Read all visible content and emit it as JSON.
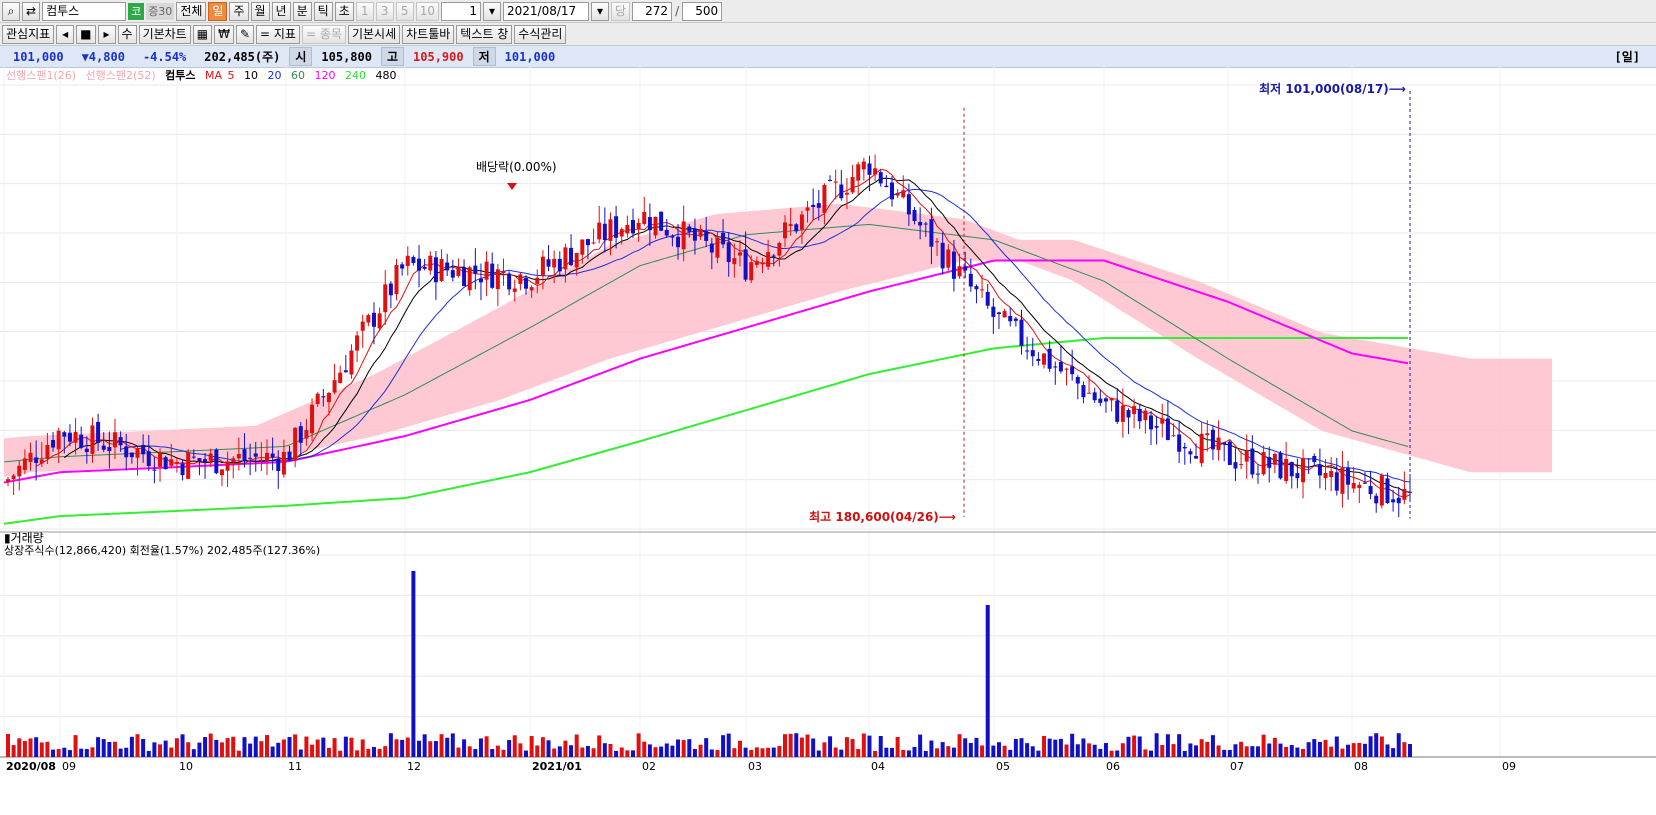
{
  "toolbar": {
    "stock_name": "컴투스",
    "market_badge": "코",
    "ratio_badge": "증30",
    "period_all": "전체",
    "period_day": "일",
    "period_week": "주",
    "period_month": "월",
    "period_year": "년",
    "period_min": "분",
    "period_tick": "틱",
    "period_sec": "초",
    "n1": "1",
    "n3": "3",
    "n5": "5",
    "n10": "10",
    "interval_value": "1",
    "date_value": "2021/08/17",
    "dang_label": "당",
    "count_value": "272",
    "slash": "/",
    "total_value": "500"
  },
  "toolbar2": {
    "fav_indicator": "관심지표",
    "basic_chart": "기본차트",
    "won": "₩",
    "add_indicator": "지표",
    "add_item": "종목",
    "basic_price": "기본시세",
    "chart_toolbar": "차트툴바",
    "text_window": "텍스트 창",
    "formula_mgmt": "수식관리"
  },
  "quote": {
    "price": "101,000",
    "change": "▼4,800",
    "change_pct": "-4.54%",
    "volume": "202,485(주)",
    "open_label": "시",
    "open": "105,800",
    "high_label": "고",
    "high": "105,900",
    "low_label": "저",
    "low": "101,000",
    "period_tag": "[일]"
  },
  "legend": {
    "span1": "선행스팬1(26)",
    "span2": "선행스팬2(52)",
    "name": "컴투스",
    "ma_label": "MA",
    "ma5": "5",
    "ma10": "10",
    "ma20": "20",
    "ma60": "60",
    "ma120": "120",
    "ma240": "240",
    "ma480": "480"
  },
  "colors": {
    "up": "#e01010",
    "down": "#1010c8",
    "ma5": "#e01010",
    "ma10": "#000000",
    "ma20": "#1a2fe0",
    "ma60": "#2e8b57",
    "ma120": "#ff00ff",
    "ma240": "#33ee33",
    "ma480": "#000000",
    "cloud": "#ffc0cb",
    "max_marker": "#d01010",
    "min_marker": "#1a1aa0"
  },
  "chart_data": {
    "type": "candlestick",
    "annotations": {
      "dividend": "배당락(0.00%)",
      "max": "최고 180,600(04/26)",
      "min": "최저 101,000(08/17)",
      "max_value": 180600,
      "min_value": 101000
    },
    "x_ticks": [
      "2020/08",
      "09",
      "10",
      "11",
      "12",
      "2021/01",
      "02",
      "03",
      "04",
      "05",
      "06",
      "07",
      "08",
      "09"
    ],
    "volume_panel": {
      "title": "거래량",
      "info": "상장주식수(12,866,420) 회전율(1.57%) 202,485주(127.36%)"
    },
    "ma_anchor_months": [
      "08",
      "09",
      "10",
      "11",
      "12",
      "01",
      "02",
      "03",
      "04",
      "05",
      "06",
      "07",
      "08",
      "09"
    ],
    "close_by_month": [
      108000,
      118000,
      112000,
      113000,
      150000,
      148000,
      160000,
      150000,
      170000,
      140000,
      123000,
      113000,
      108000,
      101000
    ],
    "ma60_by_month": [
      112000,
      113000,
      114000,
      115000,
      125000,
      138000,
      150000,
      156000,
      158000,
      155000,
      147000,
      132000,
      118000,
      110000
    ],
    "ma120_by_month": [
      108000,
      110000,
      111000,
      112000,
      117000,
      124000,
      132000,
      138000,
      145000,
      151000,
      151000,
      143000,
      133000,
      128000
    ],
    "ma240_by_month": [
      100000,
      101500,
      102500,
      103500,
      105000,
      110000,
      116000,
      122000,
      129000,
      134000,
      136000,
      136000,
      136000,
      136000
    ],
    "price_ylim": [
      99000,
      185000
    ],
    "volume_ylim": [
      0,
      1000
    ]
  }
}
